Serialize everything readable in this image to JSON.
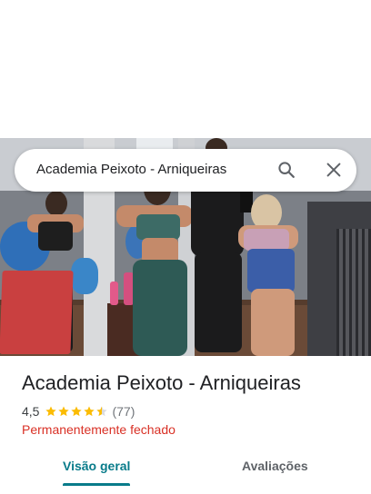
{
  "search": {
    "query": "Academia Peixoto - Arniqueiras"
  },
  "place": {
    "name": "Academia Peixoto - Arniqueiras",
    "rating": "4,5",
    "stars": 4.5,
    "review_count": "(77)",
    "status": "Permanentemente fechado"
  },
  "tabs": [
    {
      "label": "Visão geral",
      "active": true
    },
    {
      "label": "Avaliações",
      "active": false
    }
  ],
  "colors": {
    "accent": "#087b8a",
    "star": "#fbbc04",
    "status": "#d93025"
  }
}
